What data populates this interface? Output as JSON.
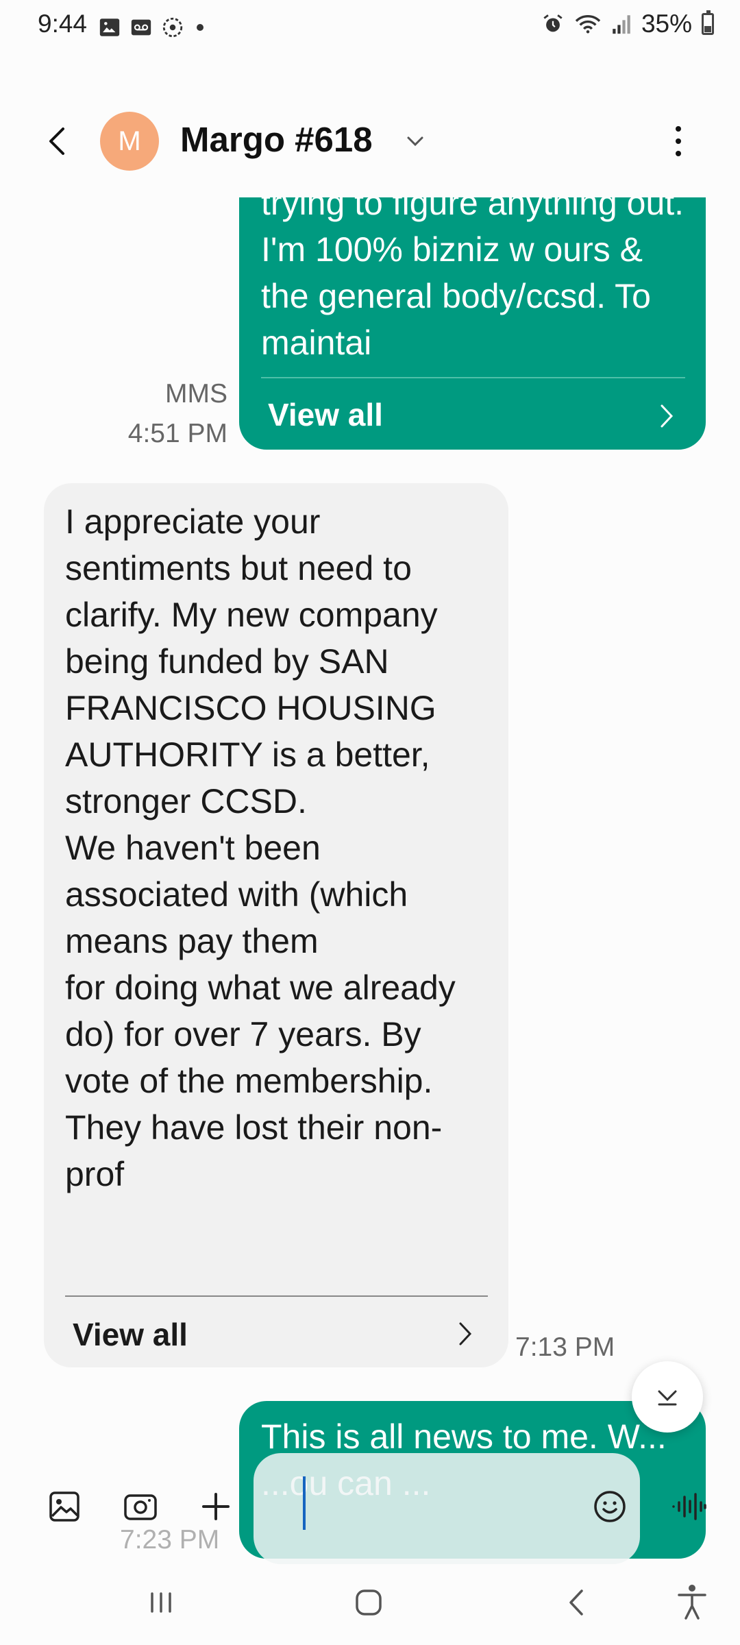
{
  "status_bar": {
    "time": "9:44",
    "battery": "35%",
    "icons_left": [
      "image-icon",
      "voicemail-icon",
      "settings-dashed-icon",
      "dot"
    ],
    "icons_right": [
      "alarm-icon",
      "wifi-icon",
      "signal-icon",
      "battery-icon"
    ]
  },
  "header": {
    "avatar_letter": "M",
    "avatar_color": "#f6a97a",
    "contact_name": "Margo #618"
  },
  "messages": {
    "out_1": {
      "text": "trying to figure anything out. I'm 100% bizniz w ours & the general body/ccsd. To maintai",
      "view_all": "View all",
      "type_label": "MMS",
      "time": "4:51 PM"
    },
    "in_1": {
      "text": "I appreciate your sentiments but need to clarify. My new company being funded by SAN FRANCISCO HOUSING AUTHORITY is a better, stronger CCSD.\nWe haven't been associated with (which means pay them\nfor doing what we already do)  for over 7 years. By vote of the membership.\nThey have lost their non-prof",
      "view_all": "View all",
      "time": "7:13 PM"
    },
    "out_2": {
      "text": "This is all news to me. W... ...ou can ...",
      "time": "7:23 PM"
    }
  },
  "composer": {
    "placeholder": ""
  },
  "colors": {
    "outgoing_bubble": "#009a80",
    "incoming_bubble": "#f1f1f1",
    "caret": "#1565c0"
  }
}
